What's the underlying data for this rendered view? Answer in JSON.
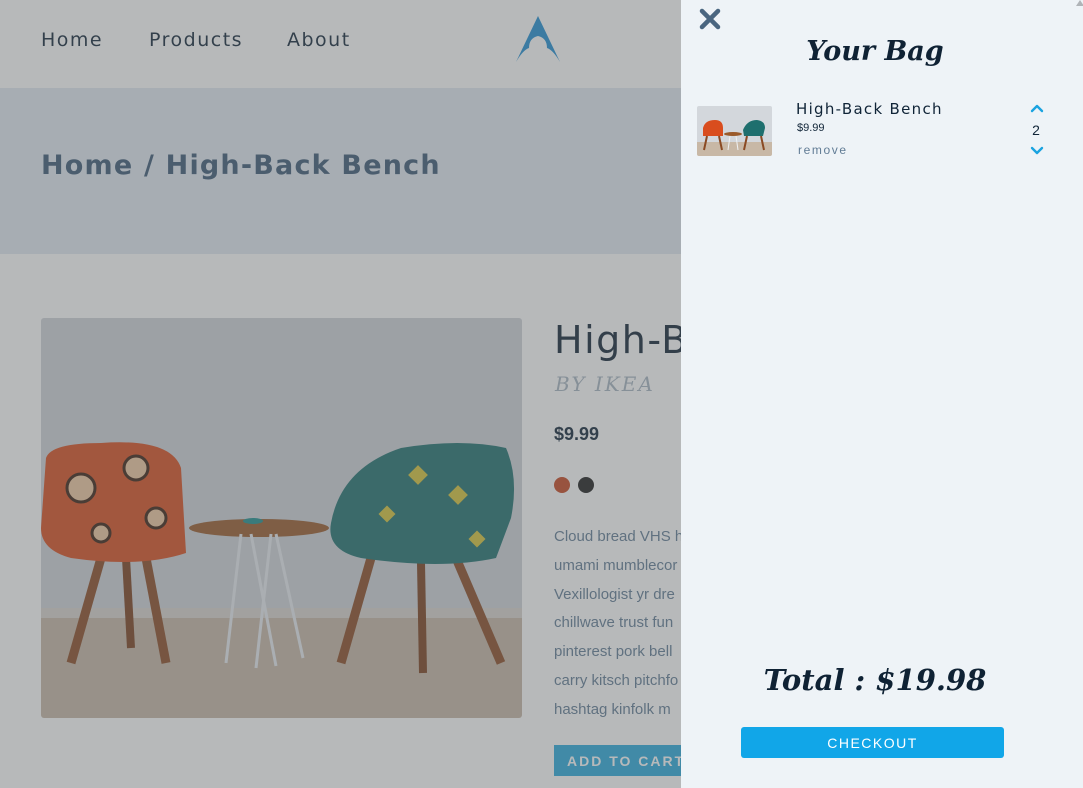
{
  "nav": {
    "links": [
      "Home",
      "Products",
      "About"
    ],
    "logo_icon": "arch-logo-icon"
  },
  "breadcrumb": "Home / High-Back Bench",
  "product": {
    "title": "High-Back Bench",
    "visible_title": "High-B",
    "brand": "BY IKEA",
    "price": "$9.99",
    "colors": [
      "#c7451f",
      "#1d1d1d"
    ],
    "description_lines": [
      "Cloud bread VHS h",
      "umami mumblecor",
      "Vexillologist yr dre",
      "chillwave trust fun",
      "pinterest pork bell",
      "carry kitsch pitchfo",
      "hashtag kinfolk m"
    ],
    "add_to_cart_label": "ADD TO CART"
  },
  "cart": {
    "close_icon": "close-icon",
    "title": "Your Bag",
    "items": [
      {
        "name": "High-Back Bench",
        "price": "$9.99",
        "remove_label": "remove",
        "quantity": "2"
      }
    ],
    "total": "Total : $19.98",
    "checkout_label": "CHECKOUT"
  },
  "colors": {
    "accent": "#11a6e8",
    "drawer_bg": "#eef3f7",
    "banner_bg": "#e2eaf2",
    "text_dark": "#0f2234",
    "overlay": "rgba(95,99,103,0.45)"
  }
}
